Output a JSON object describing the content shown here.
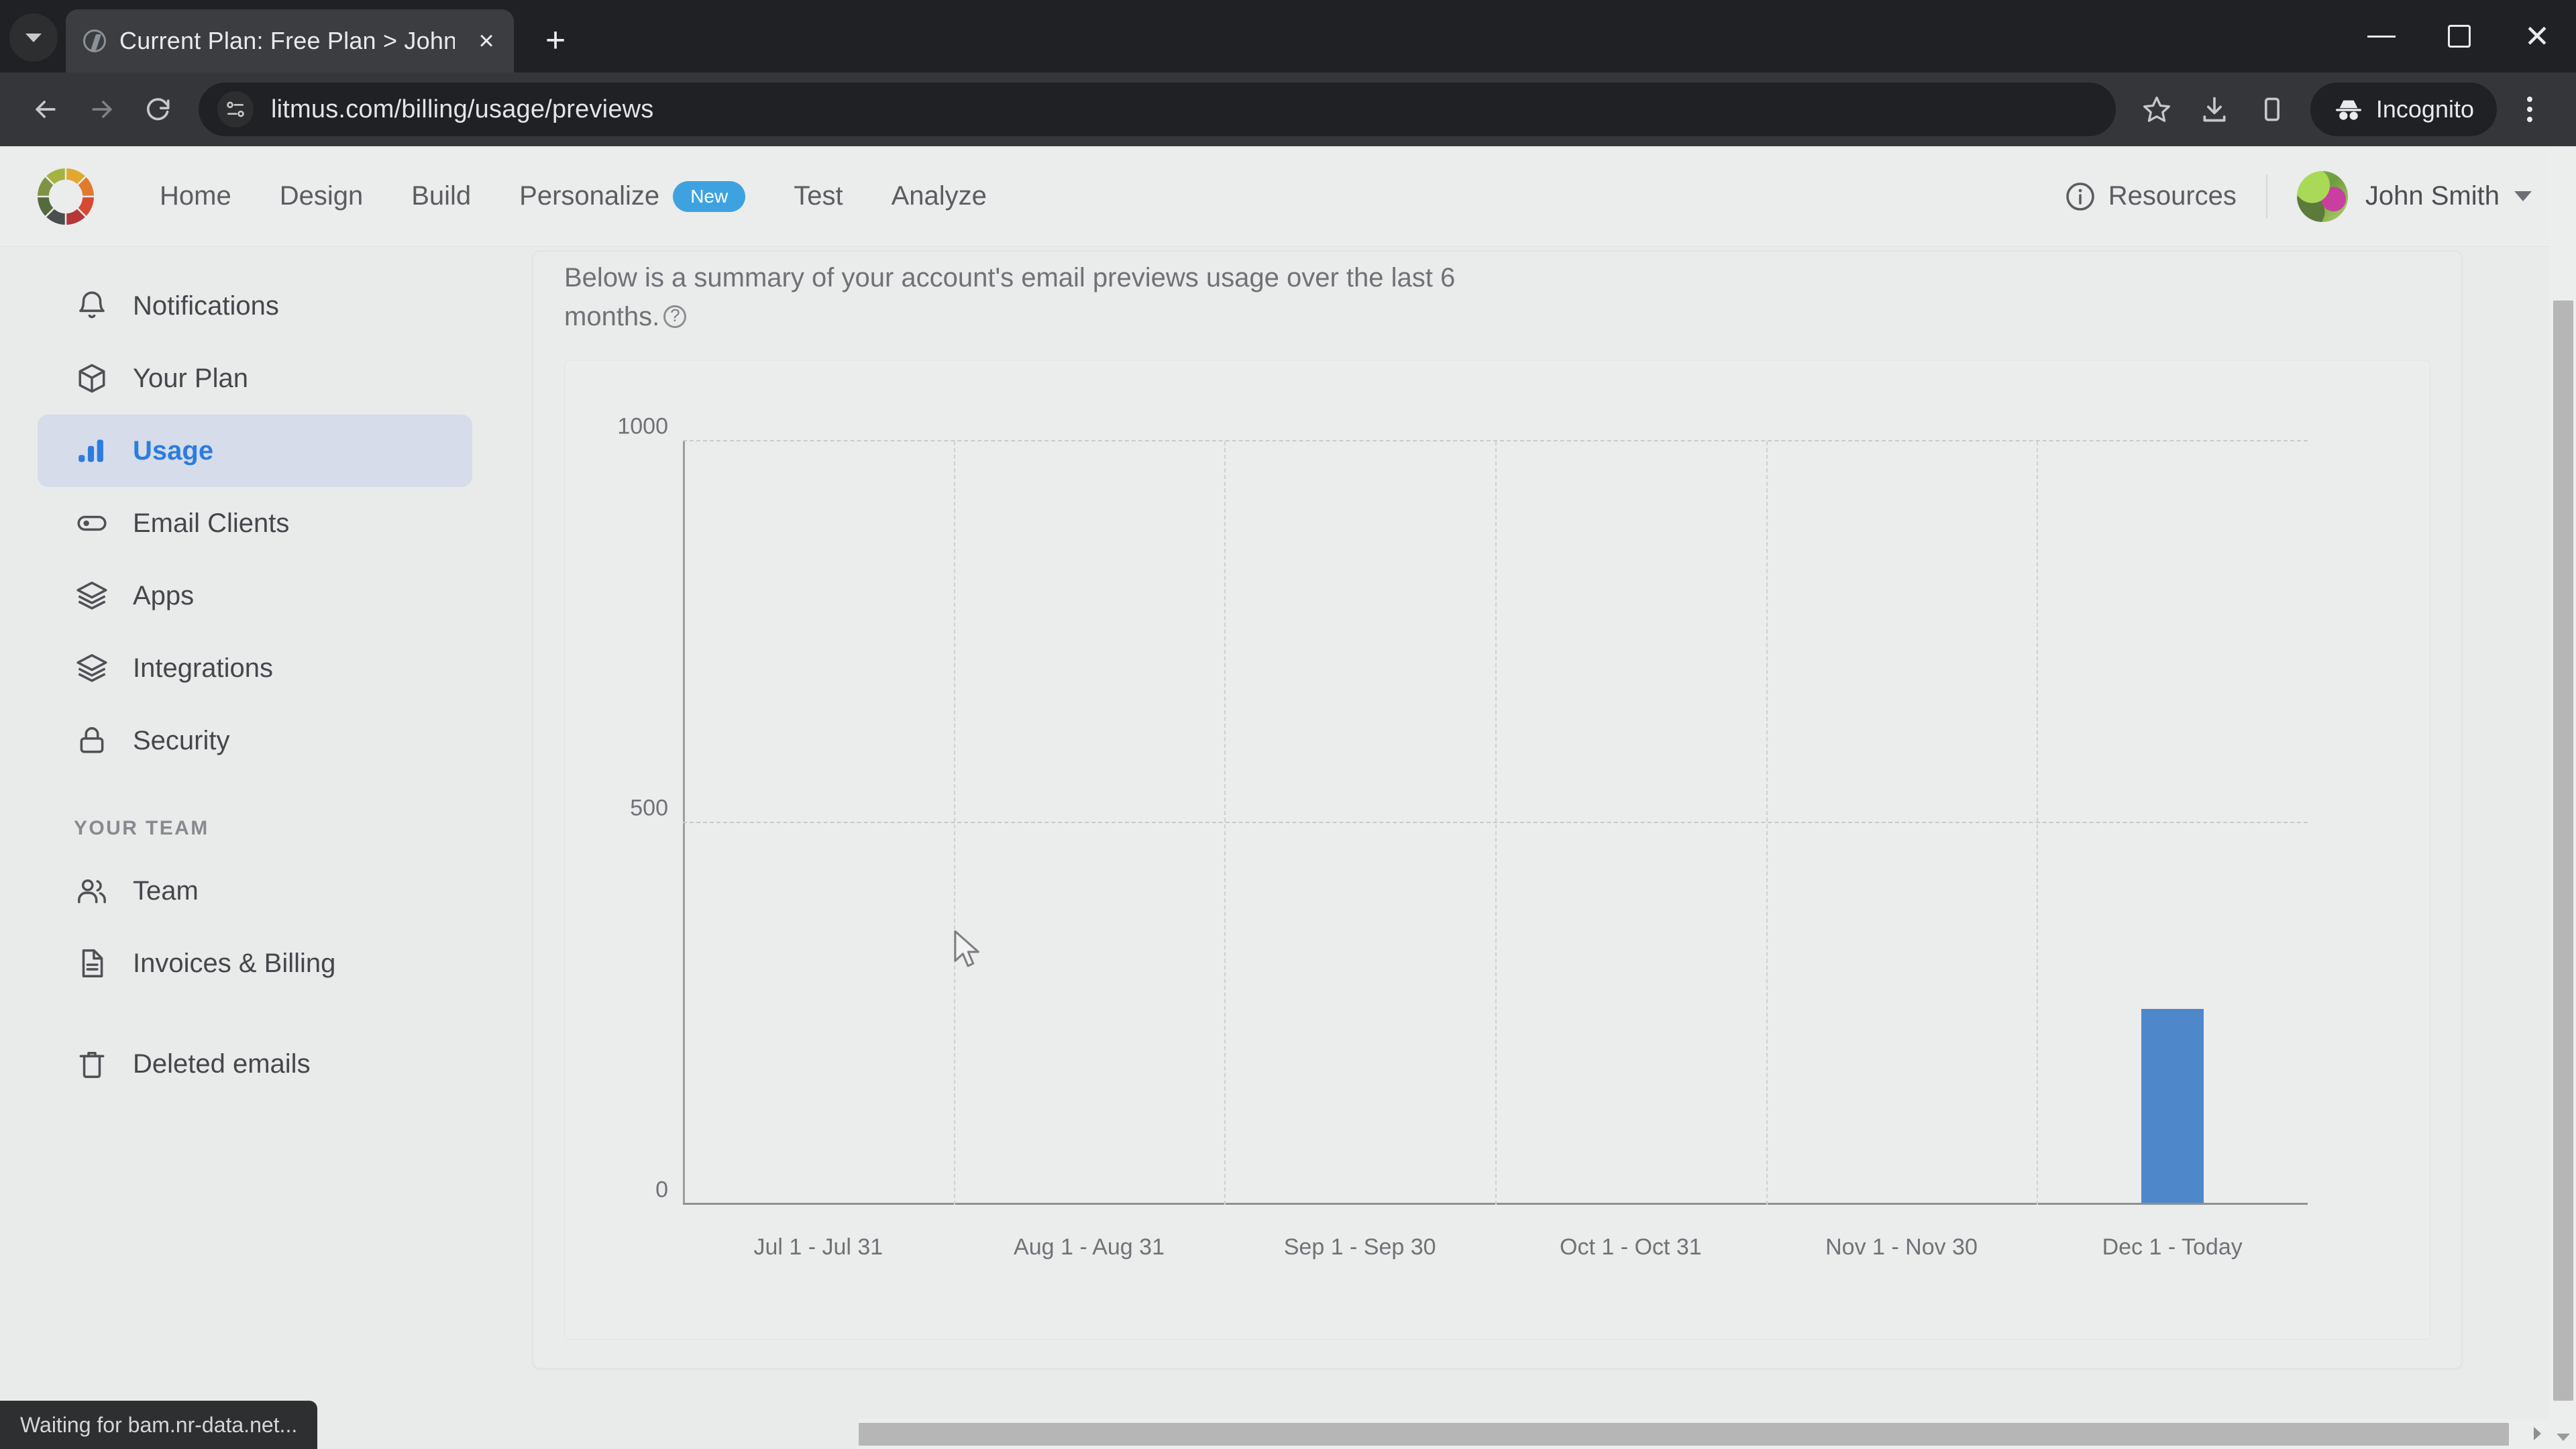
{
  "browser": {
    "tab": {
      "title": "Current Plan: Free Plan > John S",
      "favicon": "litmus-favicon",
      "close": "×"
    },
    "new_tab_label": "+",
    "url": "litmus.com/billing/usage/previews",
    "incognito_label": "Incognito",
    "status_text": "Waiting for bam.nr-data.net...",
    "window": {
      "minimize": "minimize-icon",
      "maximize": "maximize-icon",
      "close": "close-icon"
    }
  },
  "appbar": {
    "logo": "litmus-color-wheel-logo",
    "nav": [
      {
        "label": "Home"
      },
      {
        "label": "Design"
      },
      {
        "label": "Build"
      },
      {
        "label": "Personalize",
        "badge": "New"
      },
      {
        "label": "Test"
      },
      {
        "label": "Analyze"
      }
    ],
    "resources_label": "Resources",
    "user_name": "John Smith"
  },
  "sidebar": {
    "items": [
      {
        "label": "Notifications",
        "icon": "bell-icon",
        "active": false
      },
      {
        "label": "Your Plan",
        "icon": "box-icon",
        "active": false
      },
      {
        "label": "Usage",
        "icon": "bar-chart-icon",
        "active": true
      },
      {
        "label": "Email Clients",
        "icon": "toggle-icon",
        "active": false
      },
      {
        "label": "Apps",
        "icon": "layers-icon",
        "active": false
      },
      {
        "label": "Integrations",
        "icon": "layers-icon",
        "active": false
      },
      {
        "label": "Security",
        "icon": "lock-icon",
        "active": false
      }
    ],
    "group_label": "YOUR TEAM",
    "team_items": [
      {
        "label": "Team",
        "icon": "users-icon"
      },
      {
        "label": "Invoices & Billing",
        "icon": "document-icon"
      }
    ],
    "deleted_item": {
      "label": "Deleted emails",
      "icon": "trash-icon"
    }
  },
  "main": {
    "description": "Below is a summary of your account's email previews usage over the last 6 months.",
    "help_icon": "help-circle-icon"
  },
  "chart_data": {
    "type": "bar",
    "title": "",
    "xlabel": "",
    "ylabel": "",
    "categories": [
      "Jul  1 - Jul 31",
      "Aug  1 - Aug 31",
      "Sep  1 - Sep 30",
      "Oct  1 - Oct 31",
      "Nov  1 - Nov 30",
      "Dec  1 - Today"
    ],
    "values": [
      0,
      0,
      0,
      0,
      0,
      254
    ],
    "yticks": [
      0,
      500,
      1000
    ],
    "ylim": [
      0,
      1000
    ],
    "grid": true,
    "legend": false,
    "bar_color": "#4e88ca"
  },
  "colors": {
    "accent": "#2b7de0",
    "badge": "#3fa2e0",
    "bar": "#4e88ca",
    "page_bg": "#e9eaea",
    "active_nav_bg": "#d6dce9"
  }
}
